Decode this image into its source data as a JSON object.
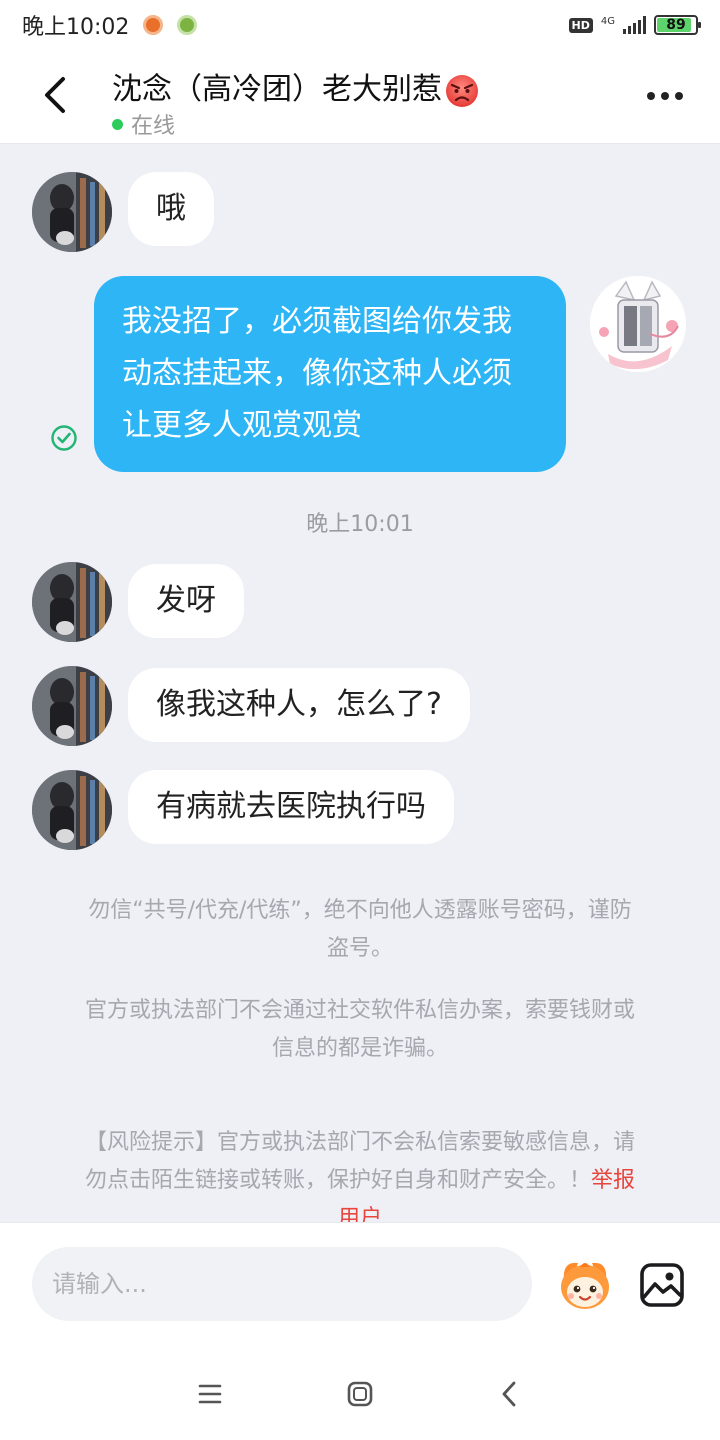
{
  "status_bar": {
    "time": "晚上10:02",
    "hd": "HD",
    "network": "4G",
    "battery_level": "89",
    "battery_fraction": 0.89
  },
  "header": {
    "contact_name": "沈念（高冷团）老大别惹",
    "status": "在线",
    "icons": [
      "back-icon",
      "angry-face-icon",
      "more-icon"
    ]
  },
  "messages": [
    {
      "side": "in",
      "text": "哦"
    },
    {
      "side": "out",
      "lines": [
        "我没招了，必须截图给你发我",
        "动态挂起来，像你这种人必须",
        "让更多人观赏观赏"
      ]
    },
    {
      "side": "in",
      "text": "发呀"
    },
    {
      "side": "in",
      "text": "像我这种人，怎么了?"
    },
    {
      "side": "in",
      "text": "有病就去医院执行吗"
    }
  ],
  "timestamp": "晚上10:01",
  "notices": {
    "notice1_line1": "勿信“共号/代充/代练”，绝不向他人透露账号密码，谨防",
    "notice1_line2": "盗号。",
    "notice2_line1": "官方或执法部门不会通过社交软件私信办案，索要钱财或",
    "notice2_line2": "信息的都是诈骗。",
    "risk_line1": "【风险提示】官方或执法部门不会私信索要敏感信息，请",
    "risk_line2": "勿点击陌生链接或转账，保护好自身和财产安全。！",
    "report_part1": "举报",
    "report_part2": "用户"
  },
  "input": {
    "placeholder": "请输入..."
  },
  "colors": {
    "outgoing_bubble": "#2db5f5",
    "online_dot": "#2dcc5a",
    "report_link": "#e8453c",
    "background": "#eef0f6"
  }
}
